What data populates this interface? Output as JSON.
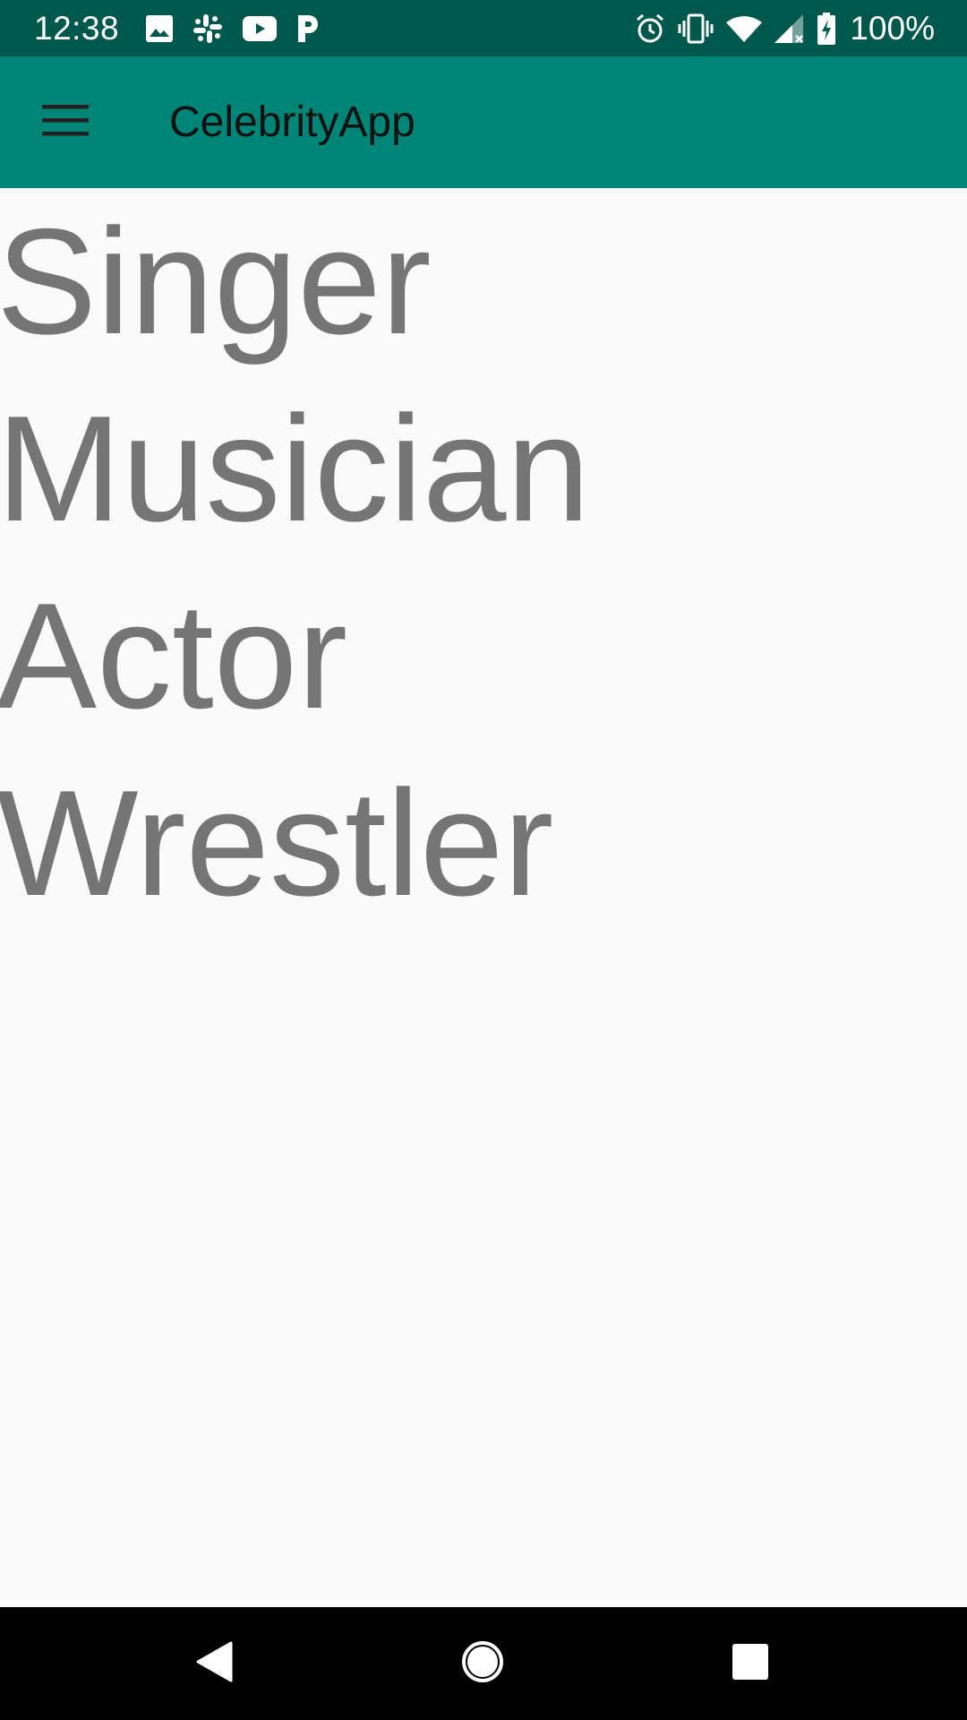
{
  "status_bar": {
    "time": "12:38",
    "battery_percent": "100%",
    "notification_icons": [
      "image-icon",
      "slack-icon",
      "youtube-icon",
      "pandora-icon"
    ],
    "system_icons": [
      "alarm-icon",
      "vibrate-icon",
      "wifi-icon",
      "signal-icon",
      "battery-charging-icon"
    ]
  },
  "app_bar": {
    "title": "CelebrityApp",
    "menu_icon": "hamburger-menu-icon"
  },
  "categories": [
    {
      "label": "Singer"
    },
    {
      "label": "Musician"
    },
    {
      "label": "Actor"
    },
    {
      "label": "Wrestler"
    }
  ],
  "nav_bar": {
    "icons": [
      "back-icon",
      "home-icon",
      "recents-icon"
    ]
  },
  "colors": {
    "status_bar": "#00574b",
    "app_bar": "#008577",
    "background": "#fafafa",
    "category_text": "#757575",
    "nav_bar": "#000000"
  }
}
